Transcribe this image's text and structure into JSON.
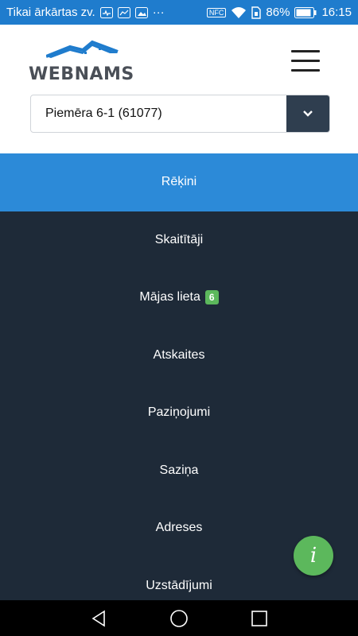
{
  "status_bar": {
    "carrier": "Tikai ārkārtas zv.",
    "nfc": "NFC",
    "battery": "86%",
    "time": "16:15"
  },
  "header": {
    "logo_text": "WEBNAMS",
    "property_select": {
      "value": "Piemēra 6-1 (61077)"
    }
  },
  "menu": {
    "items": [
      {
        "label": "Rēķini",
        "active": true
      },
      {
        "label": "Skaitītāji"
      },
      {
        "label": "Mājas lieta",
        "badge": "6"
      },
      {
        "label": "Atskaites"
      },
      {
        "label": "Paziņojumi"
      },
      {
        "label": "Saziņa"
      },
      {
        "label": "Adreses"
      },
      {
        "label": "Uzstādījumi"
      }
    ]
  },
  "info_button": {
    "label": "i"
  },
  "colors": {
    "status_bar": "#1f7ccd",
    "active_item": "#2c8ad8",
    "menu_bg": "#1e2a38",
    "badge": "#5cb85c",
    "fab": "#5cb85c"
  }
}
